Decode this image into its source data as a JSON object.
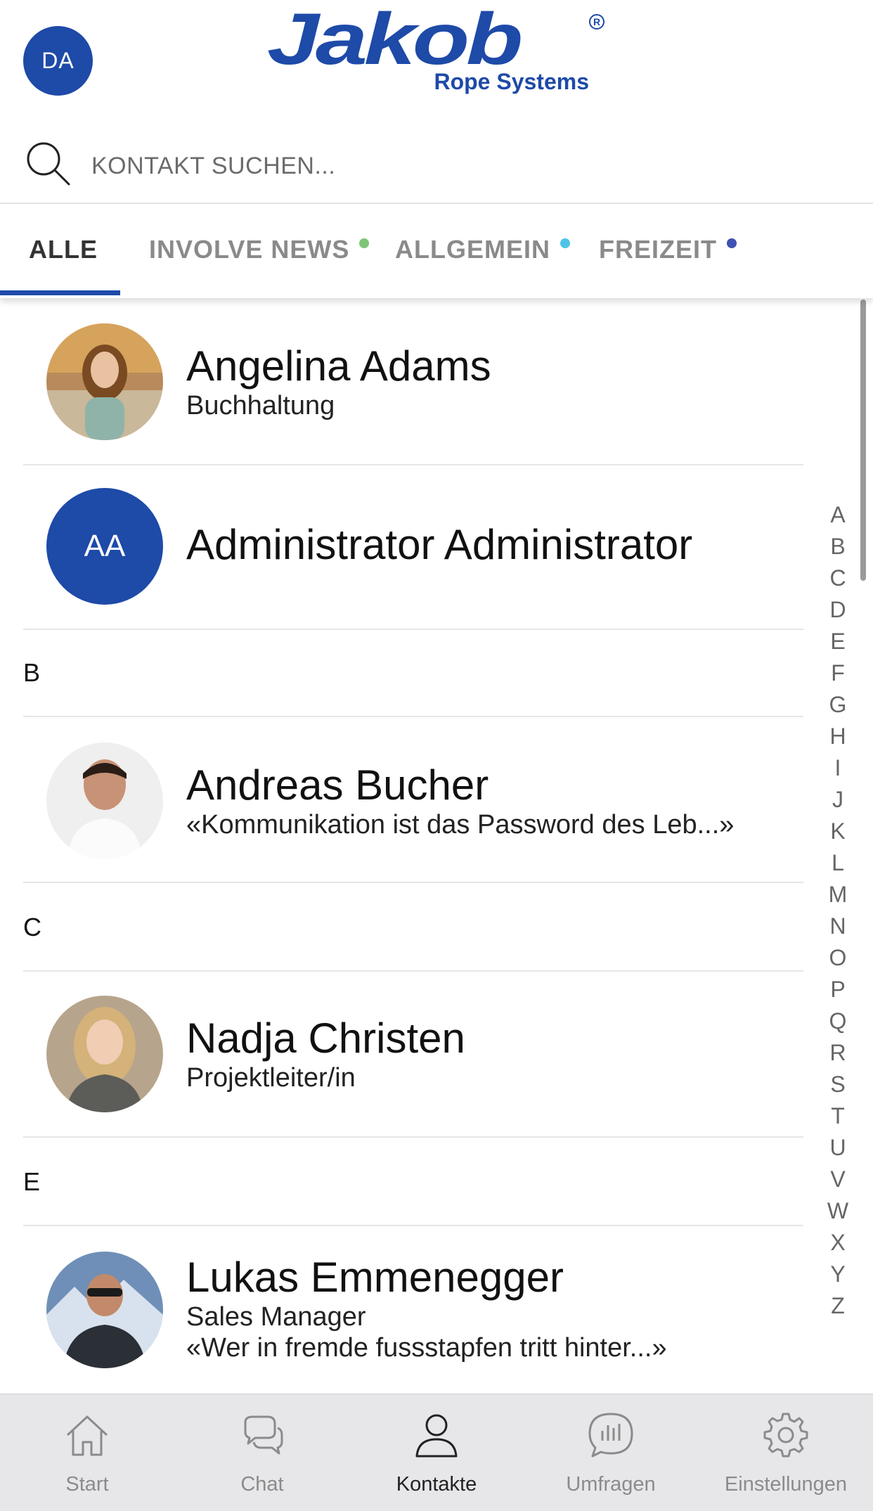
{
  "header": {
    "user_initials": "DA",
    "logo_word": "Jakob",
    "logo_reg": "R",
    "logo_sub": "Rope Systems",
    "brand_color": "#1e4aa8"
  },
  "search": {
    "placeholder": "KONTAKT SUCHEN..."
  },
  "tabs": [
    {
      "label": "ALLE",
      "active": true
    },
    {
      "label": "INVOLVE NEWS",
      "dot_color": "#7cc576"
    },
    {
      "label": "ALLGEMEIN",
      "dot_color": "#4fc3e6"
    },
    {
      "label": "FREIZEIT",
      "dot_color": "#3f51b5"
    }
  ],
  "contacts": [
    {
      "name": "Angelina Adams",
      "subtitle": "Buchhaltung"
    },
    {
      "name": "Administrator Administrator",
      "initials": "AA"
    },
    {
      "name": "Andreas Bucher",
      "subtitle": "«Kommunikation ist das Password des Leb...»"
    },
    {
      "name": "Nadja Christen",
      "subtitle": "Projektleiter/in"
    },
    {
      "name": "Lukas Emmenegger",
      "subtitle": "Sales Manager",
      "subtitle2": "«Wer in fremde fussstapfen tritt hinter...»"
    }
  ],
  "sections": [
    "B",
    "C",
    "E"
  ],
  "alphabet": [
    "A",
    "B",
    "C",
    "D",
    "E",
    "F",
    "G",
    "H",
    "I",
    "J",
    "K",
    "L",
    "M",
    "N",
    "O",
    "P",
    "Q",
    "R",
    "S",
    "T",
    "U",
    "V",
    "W",
    "X",
    "Y",
    "Z"
  ],
  "bottom_nav": [
    {
      "label": "Start",
      "icon": "home-icon"
    },
    {
      "label": "Chat",
      "icon": "chat-icon"
    },
    {
      "label": "Kontakte",
      "icon": "contact-icon",
      "active": true
    },
    {
      "label": "Umfragen",
      "icon": "poll-icon"
    },
    {
      "label": "Einstellungen",
      "icon": "gear-icon"
    }
  ]
}
